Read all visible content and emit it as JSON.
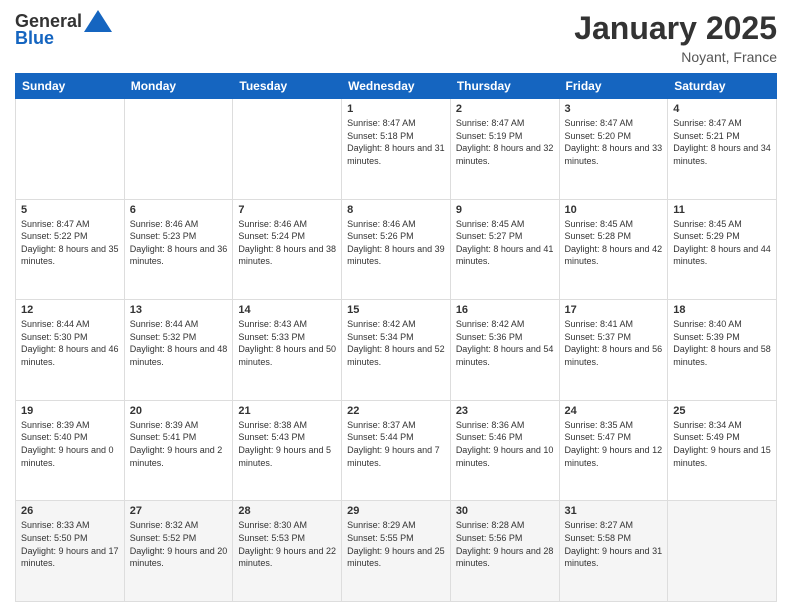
{
  "header": {
    "logo_general": "General",
    "logo_blue": "Blue",
    "title": "January 2025",
    "location": "Noyant, France"
  },
  "days_of_week": [
    "Sunday",
    "Monday",
    "Tuesday",
    "Wednesday",
    "Thursday",
    "Friday",
    "Saturday"
  ],
  "weeks": [
    [
      {
        "day": "",
        "sunrise": "",
        "sunset": "",
        "daylight": ""
      },
      {
        "day": "",
        "sunrise": "",
        "sunset": "",
        "daylight": ""
      },
      {
        "day": "",
        "sunrise": "",
        "sunset": "",
        "daylight": ""
      },
      {
        "day": "1",
        "sunrise": "Sunrise: 8:47 AM",
        "sunset": "Sunset: 5:18 PM",
        "daylight": "Daylight: 8 hours and 31 minutes."
      },
      {
        "day": "2",
        "sunrise": "Sunrise: 8:47 AM",
        "sunset": "Sunset: 5:19 PM",
        "daylight": "Daylight: 8 hours and 32 minutes."
      },
      {
        "day": "3",
        "sunrise": "Sunrise: 8:47 AM",
        "sunset": "Sunset: 5:20 PM",
        "daylight": "Daylight: 8 hours and 33 minutes."
      },
      {
        "day": "4",
        "sunrise": "Sunrise: 8:47 AM",
        "sunset": "Sunset: 5:21 PM",
        "daylight": "Daylight: 8 hours and 34 minutes."
      }
    ],
    [
      {
        "day": "5",
        "sunrise": "Sunrise: 8:47 AM",
        "sunset": "Sunset: 5:22 PM",
        "daylight": "Daylight: 8 hours and 35 minutes."
      },
      {
        "day": "6",
        "sunrise": "Sunrise: 8:46 AM",
        "sunset": "Sunset: 5:23 PM",
        "daylight": "Daylight: 8 hours and 36 minutes."
      },
      {
        "day": "7",
        "sunrise": "Sunrise: 8:46 AM",
        "sunset": "Sunset: 5:24 PM",
        "daylight": "Daylight: 8 hours and 38 minutes."
      },
      {
        "day": "8",
        "sunrise": "Sunrise: 8:46 AM",
        "sunset": "Sunset: 5:26 PM",
        "daylight": "Daylight: 8 hours and 39 minutes."
      },
      {
        "day": "9",
        "sunrise": "Sunrise: 8:45 AM",
        "sunset": "Sunset: 5:27 PM",
        "daylight": "Daylight: 8 hours and 41 minutes."
      },
      {
        "day": "10",
        "sunrise": "Sunrise: 8:45 AM",
        "sunset": "Sunset: 5:28 PM",
        "daylight": "Daylight: 8 hours and 42 minutes."
      },
      {
        "day": "11",
        "sunrise": "Sunrise: 8:45 AM",
        "sunset": "Sunset: 5:29 PM",
        "daylight": "Daylight: 8 hours and 44 minutes."
      }
    ],
    [
      {
        "day": "12",
        "sunrise": "Sunrise: 8:44 AM",
        "sunset": "Sunset: 5:30 PM",
        "daylight": "Daylight: 8 hours and 46 minutes."
      },
      {
        "day": "13",
        "sunrise": "Sunrise: 8:44 AM",
        "sunset": "Sunset: 5:32 PM",
        "daylight": "Daylight: 8 hours and 48 minutes."
      },
      {
        "day": "14",
        "sunrise": "Sunrise: 8:43 AM",
        "sunset": "Sunset: 5:33 PM",
        "daylight": "Daylight: 8 hours and 50 minutes."
      },
      {
        "day": "15",
        "sunrise": "Sunrise: 8:42 AM",
        "sunset": "Sunset: 5:34 PM",
        "daylight": "Daylight: 8 hours and 52 minutes."
      },
      {
        "day": "16",
        "sunrise": "Sunrise: 8:42 AM",
        "sunset": "Sunset: 5:36 PM",
        "daylight": "Daylight: 8 hours and 54 minutes."
      },
      {
        "day": "17",
        "sunrise": "Sunrise: 8:41 AM",
        "sunset": "Sunset: 5:37 PM",
        "daylight": "Daylight: 8 hours and 56 minutes."
      },
      {
        "day": "18",
        "sunrise": "Sunrise: 8:40 AM",
        "sunset": "Sunset: 5:39 PM",
        "daylight": "Daylight: 8 hours and 58 minutes."
      }
    ],
    [
      {
        "day": "19",
        "sunrise": "Sunrise: 8:39 AM",
        "sunset": "Sunset: 5:40 PM",
        "daylight": "Daylight: 9 hours and 0 minutes."
      },
      {
        "day": "20",
        "sunrise": "Sunrise: 8:39 AM",
        "sunset": "Sunset: 5:41 PM",
        "daylight": "Daylight: 9 hours and 2 minutes."
      },
      {
        "day": "21",
        "sunrise": "Sunrise: 8:38 AM",
        "sunset": "Sunset: 5:43 PM",
        "daylight": "Daylight: 9 hours and 5 minutes."
      },
      {
        "day": "22",
        "sunrise": "Sunrise: 8:37 AM",
        "sunset": "Sunset: 5:44 PM",
        "daylight": "Daylight: 9 hours and 7 minutes."
      },
      {
        "day": "23",
        "sunrise": "Sunrise: 8:36 AM",
        "sunset": "Sunset: 5:46 PM",
        "daylight": "Daylight: 9 hours and 10 minutes."
      },
      {
        "day": "24",
        "sunrise": "Sunrise: 8:35 AM",
        "sunset": "Sunset: 5:47 PM",
        "daylight": "Daylight: 9 hours and 12 minutes."
      },
      {
        "day": "25",
        "sunrise": "Sunrise: 8:34 AM",
        "sunset": "Sunset: 5:49 PM",
        "daylight": "Daylight: 9 hours and 15 minutes."
      }
    ],
    [
      {
        "day": "26",
        "sunrise": "Sunrise: 8:33 AM",
        "sunset": "Sunset: 5:50 PM",
        "daylight": "Daylight: 9 hours and 17 minutes."
      },
      {
        "day": "27",
        "sunrise": "Sunrise: 8:32 AM",
        "sunset": "Sunset: 5:52 PM",
        "daylight": "Daylight: 9 hours and 20 minutes."
      },
      {
        "day": "28",
        "sunrise": "Sunrise: 8:30 AM",
        "sunset": "Sunset: 5:53 PM",
        "daylight": "Daylight: 9 hours and 22 minutes."
      },
      {
        "day": "29",
        "sunrise": "Sunrise: 8:29 AM",
        "sunset": "Sunset: 5:55 PM",
        "daylight": "Daylight: 9 hours and 25 minutes."
      },
      {
        "day": "30",
        "sunrise": "Sunrise: 8:28 AM",
        "sunset": "Sunset: 5:56 PM",
        "daylight": "Daylight: 9 hours and 28 minutes."
      },
      {
        "day": "31",
        "sunrise": "Sunrise: 8:27 AM",
        "sunset": "Sunset: 5:58 PM",
        "daylight": "Daylight: 9 hours and 31 minutes."
      },
      {
        "day": "",
        "sunrise": "",
        "sunset": "",
        "daylight": ""
      }
    ]
  ]
}
